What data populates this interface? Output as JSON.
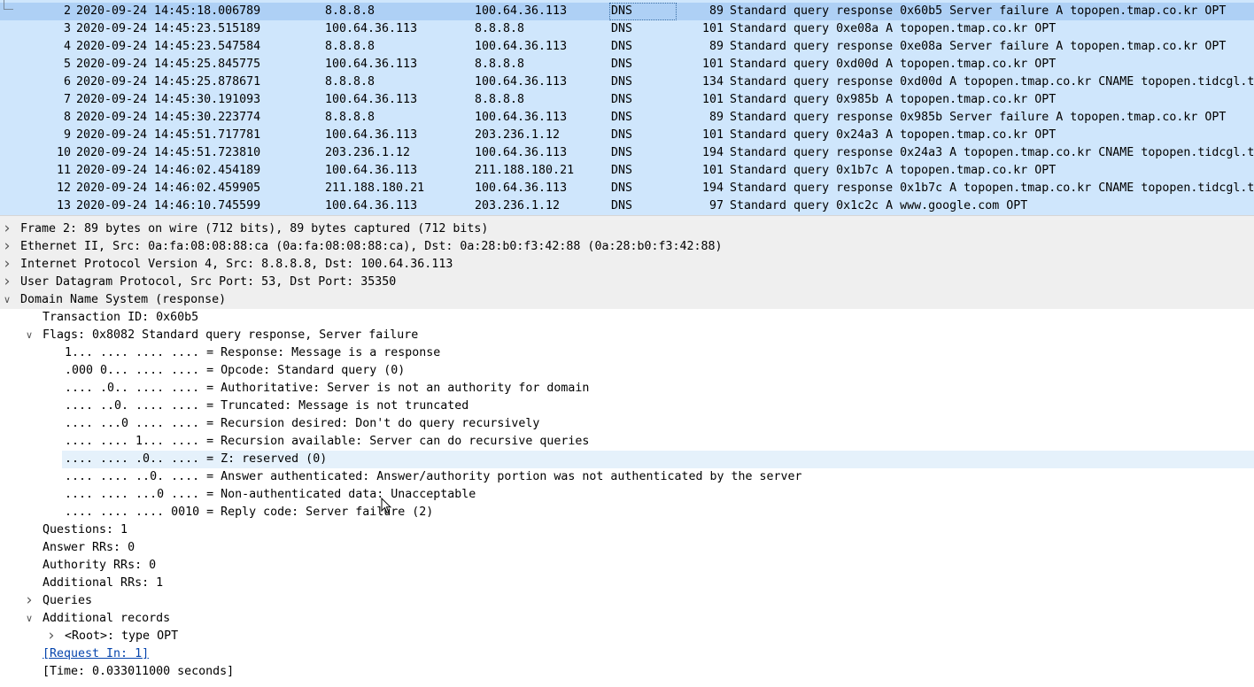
{
  "packet_list": {
    "rows": [
      {
        "no": "2",
        "time": "2020-09-24 14:45:18.006789",
        "src": "8.8.8.8",
        "dst": "100.64.36.113",
        "proto": "DNS",
        "len": "89",
        "info": "Standard query response 0x60b5 Server failure A topopen.tmap.co.kr OPT",
        "selected": true
      },
      {
        "no": "3",
        "time": "2020-09-24 14:45:23.515189",
        "src": "100.64.36.113",
        "dst": "8.8.8.8",
        "proto": "DNS",
        "len": "101",
        "info": "Standard query 0xe08a A topopen.tmap.co.kr OPT"
      },
      {
        "no": "4",
        "time": "2020-09-24 14:45:23.547584",
        "src": "8.8.8.8",
        "dst": "100.64.36.113",
        "proto": "DNS",
        "len": "89",
        "info": "Standard query response 0xe08a Server failure A topopen.tmap.co.kr OPT"
      },
      {
        "no": "5",
        "time": "2020-09-24 14:45:25.845775",
        "src": "100.64.36.113",
        "dst": "8.8.8.8",
        "proto": "DNS",
        "len": "101",
        "info": "Standard query 0xd00d A topopen.tmap.co.kr OPT"
      },
      {
        "no": "6",
        "time": "2020-09-24 14:45:25.878671",
        "src": "8.8.8.8",
        "dst": "100.64.36.113",
        "proto": "DNS",
        "len": "134",
        "info": "Standard query response 0xd00d A topopen.tmap.co.kr CNAME topopen.tidcgl.t"
      },
      {
        "no": "7",
        "time": "2020-09-24 14:45:30.191093",
        "src": "100.64.36.113",
        "dst": "8.8.8.8",
        "proto": "DNS",
        "len": "101",
        "info": "Standard query 0x985b A topopen.tmap.co.kr OPT"
      },
      {
        "no": "8",
        "time": "2020-09-24 14:45:30.223774",
        "src": "8.8.8.8",
        "dst": "100.64.36.113",
        "proto": "DNS",
        "len": "89",
        "info": "Standard query response 0x985b Server failure A topopen.tmap.co.kr OPT"
      },
      {
        "no": "9",
        "time": "2020-09-24 14:45:51.717781",
        "src": "100.64.36.113",
        "dst": "203.236.1.12",
        "proto": "DNS",
        "len": "101",
        "info": "Standard query 0x24a3 A topopen.tmap.co.kr OPT"
      },
      {
        "no": "10",
        "time": "2020-09-24 14:45:51.723810",
        "src": "203.236.1.12",
        "dst": "100.64.36.113",
        "proto": "DNS",
        "len": "194",
        "info": "Standard query response 0x24a3 A topopen.tmap.co.kr CNAME topopen.tidcgl.t"
      },
      {
        "no": "11",
        "time": "2020-09-24 14:46:02.454189",
        "src": "100.64.36.113",
        "dst": "211.188.180.21",
        "proto": "DNS",
        "len": "101",
        "info": "Standard query 0x1b7c A topopen.tmap.co.kr OPT"
      },
      {
        "no": "12",
        "time": "2020-09-24 14:46:02.459905",
        "src": "211.188.180.21",
        "dst": "100.64.36.113",
        "proto": "DNS",
        "len": "194",
        "info": "Standard query response 0x1b7c A topopen.tmap.co.kr CNAME topopen.tidcgl.t"
      },
      {
        "no": "13",
        "time": "2020-09-24 14:46:10.745599",
        "src": "100.64.36.113",
        "dst": "203.236.1.12",
        "proto": "DNS",
        "len": "97",
        "info": "Standard query 0x1c2c A www.google.com OPT"
      }
    ]
  },
  "details": {
    "rows": [
      {
        "level": 0,
        "arrow": "right",
        "text": "Frame 2: 89 bytes on wire (712 bits), 89 bytes captured (712 bits)",
        "name": "frame-node"
      },
      {
        "level": 0,
        "arrow": "right",
        "text": "Ethernet II, Src: 0a:fa:08:08:88:ca (0a:fa:08:08:88:ca), Dst: 0a:28:b0:f3:42:88 (0a:28:b0:f3:42:88)",
        "name": "ethernet-node"
      },
      {
        "level": 0,
        "arrow": "right",
        "text": "Internet Protocol Version 4, Src: 8.8.8.8, Dst: 100.64.36.113",
        "name": "ip-node"
      },
      {
        "level": 0,
        "arrow": "right",
        "text": "User Datagram Protocol, Src Port: 53, Dst Port: 35350",
        "name": "udp-node"
      },
      {
        "level": 0,
        "arrow": "down",
        "text": "Domain Name System (response)",
        "name": "dns-node"
      },
      {
        "level": 1,
        "arrow": "",
        "text": "Transaction ID: 0x60b5",
        "name": "transaction-id"
      },
      {
        "level": 1,
        "arrow": "down",
        "text": "Flags: 0x8082 Standard query response, Server failure",
        "name": "flags-node"
      },
      {
        "level": 2,
        "arrow": "",
        "text": "1... .... .... .... = Response: Message is a response",
        "name": "flag-response"
      },
      {
        "level": 2,
        "arrow": "",
        "text": ".000 0... .... .... = Opcode: Standard query (0)",
        "name": "flag-opcode"
      },
      {
        "level": 2,
        "arrow": "",
        "text": ".... .0.. .... .... = Authoritative: Server is not an authority for domain",
        "name": "flag-authoritative"
      },
      {
        "level": 2,
        "arrow": "",
        "text": ".... ..0. .... .... = Truncated: Message is not truncated",
        "name": "flag-truncated"
      },
      {
        "level": 2,
        "arrow": "",
        "text": ".... ...0 .... .... = Recursion desired: Don't do query recursively",
        "name": "flag-recursion-desired"
      },
      {
        "level": 2,
        "arrow": "",
        "text": ".... .... 1... .... = Recursion available: Server can do recursive queries",
        "name": "flag-recursion-available"
      },
      {
        "level": 2,
        "arrow": "",
        "text": ".... .... .0.. .... = Z: reserved (0)",
        "name": "flag-z",
        "hl": true
      },
      {
        "level": 2,
        "arrow": "",
        "text": ".... .... ..0. .... = Answer authenticated: Answer/authority portion was not authenticated by the server",
        "name": "flag-answer-authenticated"
      },
      {
        "level": 2,
        "arrow": "",
        "text": ".... .... ...0 .... = Non-authenticated data: Unacceptable",
        "name": "flag-non-authenticated"
      },
      {
        "level": 2,
        "arrow": "",
        "text": ".... .... .... 0010 = Reply code: Server failure (2)",
        "name": "flag-reply-code"
      },
      {
        "level": 1,
        "arrow": "",
        "text": "Questions: 1",
        "name": "questions-count"
      },
      {
        "level": 1,
        "arrow": "",
        "text": "Answer RRs: 0",
        "name": "answer-rrs"
      },
      {
        "level": 1,
        "arrow": "",
        "text": "Authority RRs: 0",
        "name": "authority-rrs"
      },
      {
        "level": 1,
        "arrow": "",
        "text": "Additional RRs: 1",
        "name": "additional-rrs"
      },
      {
        "level": 1,
        "arrow": "right",
        "text": "Queries",
        "name": "queries-node"
      },
      {
        "level": 1,
        "arrow": "down",
        "text": "Additional records",
        "name": "additional-records-node"
      },
      {
        "level": 2,
        "arrow": "right",
        "text": "<Root>: type OPT",
        "name": "root-opt-node"
      },
      {
        "level": 1,
        "arrow": "",
        "text": "[Request In: 1]",
        "name": "request-in-link",
        "link": true
      },
      {
        "level": 1,
        "arrow": "",
        "text": "[Time: 0.033011000 seconds]",
        "name": "response-time"
      }
    ]
  }
}
